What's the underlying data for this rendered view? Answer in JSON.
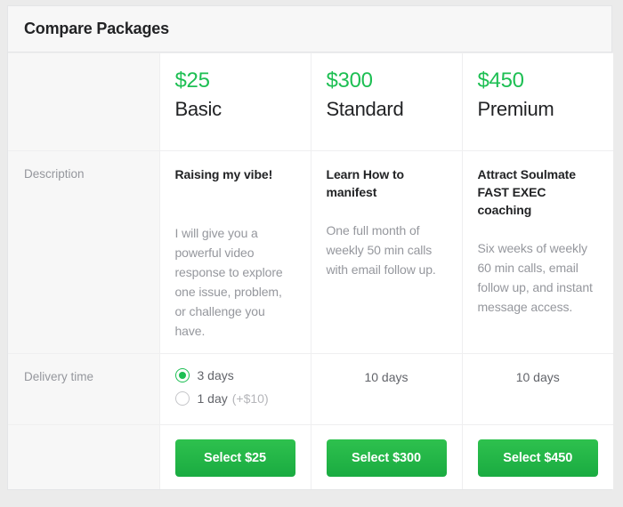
{
  "panel": {
    "title": "Compare Packages"
  },
  "rows": {
    "description_label": "Description",
    "delivery_label": "Delivery time"
  },
  "colors": {
    "price_green": "#1dbf53",
    "button_green": "#1dbf53",
    "label_grey": "#95979d",
    "header_bg": "#f7f7f7",
    "page_bg": "#ebebeb"
  },
  "packages": [
    {
      "price": "$25",
      "name": "Basic",
      "desc_title": "Raising my vibe!",
      "desc_body": "I will give you a powerful video response to explore one issue, problem, or challenge you have.",
      "delivery_type": "radio",
      "delivery_options": [
        {
          "label": "3 days",
          "extra": "",
          "selected": true
        },
        {
          "label": "1 day",
          "extra": "(+$10)",
          "selected": false
        }
      ],
      "delivery_text": "",
      "button_label": "Select $25"
    },
    {
      "price": "$300",
      "name": "Standard",
      "desc_title": "Learn How to manifest",
      "desc_body": "One full month of weekly 50 min calls with email follow up.",
      "delivery_type": "text",
      "delivery_options": [],
      "delivery_text": "10 days",
      "button_label": "Select $300"
    },
    {
      "price": "$450",
      "name": "Premium",
      "desc_title": "Attract Soulmate FAST EXEC coaching",
      "desc_body": "Six weeks of weekly 60 min calls, email follow up, and instant message access.",
      "delivery_type": "text",
      "delivery_options": [],
      "delivery_text": "10 days",
      "button_label": "Select $450"
    }
  ]
}
